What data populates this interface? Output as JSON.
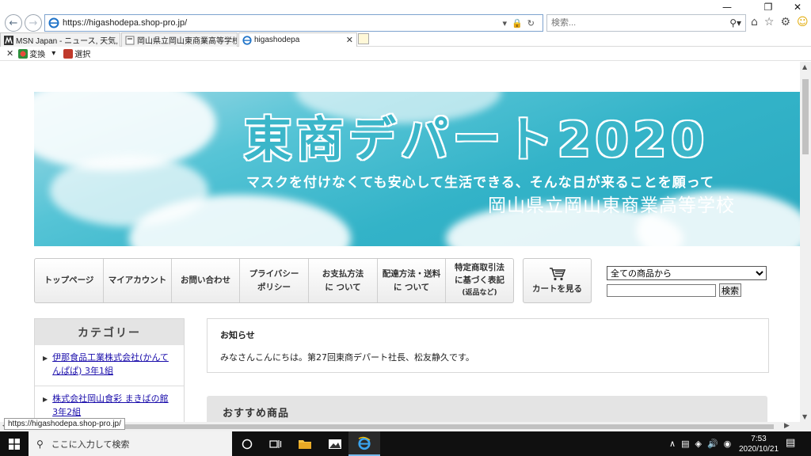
{
  "browser": {
    "url": "https://higashodepa.shop-pro.jp/",
    "search_placeholder": "検索...",
    "tabs": [
      {
        "label": "MSN Japan - ニュース, 天気, メー..."
      },
      {
        "label": "岡山県立岡山東商業高等学校"
      },
      {
        "label": "higashodepa"
      }
    ],
    "cmdbar": {
      "convert": "変換",
      "select": "選択"
    },
    "status_url": "https://higashodepa.shop-pro.jp/"
  },
  "banner": {
    "title": "東商デパート2020",
    "subtitle": "マスクを付けなくても安心して生活できる、そんな日が来ることを願って",
    "school": "岡山県立岡山東商業高等学校"
  },
  "gnav": [
    {
      "label": "トップページ"
    },
    {
      "label": "マイアカウント"
    },
    {
      "label": "お問い合わせ"
    },
    {
      "line1": "プライバシー",
      "line2": "ポリシー"
    },
    {
      "line1": "お支払方法",
      "line2": "に ついて"
    },
    {
      "line1": "配達方法・送料",
      "line2": "に ついて"
    },
    {
      "line1": "特定商取引法",
      "line2": "に基づく表記",
      "line3": "(返品など)"
    }
  ],
  "cart": {
    "label": "カートを見る"
  },
  "site_search": {
    "selected": "全ての商品から",
    "button": "検索",
    "value": ""
  },
  "category": {
    "heading": "カテゴリー",
    "items": [
      {
        "label": "伊那食品工業株式会社(かんてんぱぱ) 3年1組"
      },
      {
        "label": "株式会社岡山食彩 まきばの館 3年2組"
      }
    ]
  },
  "news": {
    "title": "お知らせ",
    "body": "みなさんこんにちは。第27回東商デパート社長、松友静久です。"
  },
  "recommend": {
    "title": "おすすめ商品"
  },
  "taskbar": {
    "search_placeholder": "ここに入力して検索",
    "time": "7:53",
    "date": "2020/10/21"
  }
}
